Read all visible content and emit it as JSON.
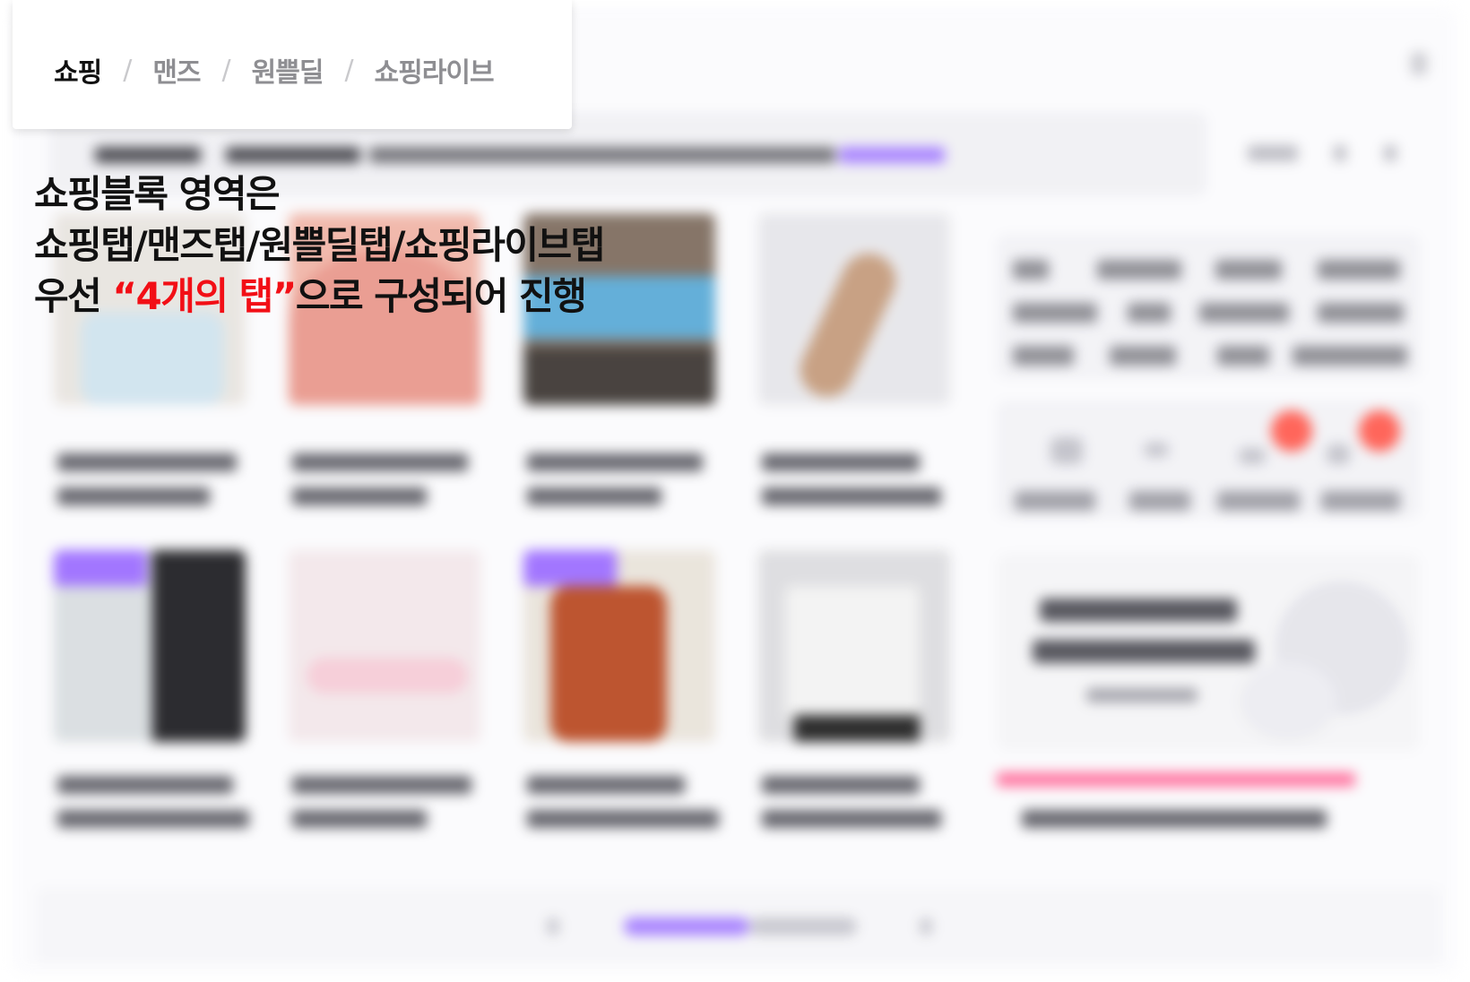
{
  "tabs": [
    {
      "label": "쇼핑",
      "active": true
    },
    {
      "label": "맨즈",
      "active": false
    },
    {
      "label": "원쁠딜",
      "active": false
    },
    {
      "label": "쇼핑라이브",
      "active": false
    }
  ],
  "tab_separator": "/",
  "annotation": {
    "line1": "쇼핑블록 영역은",
    "line2": "쇼핑탭/맨즈탭/원쁠딜탭/쇼핑라이브탭",
    "line3_before": "우선 ",
    "line3_highlight": "“4개의 탭”",
    "line3_after": "으로 구성되어 진행"
  },
  "colors": {
    "highlight": "#f20f16",
    "accent_purple": "#9b6bff",
    "badge_red": "#ff5a4e",
    "tab_active": "#111111",
    "tab_inactive": "#8e8e92"
  }
}
